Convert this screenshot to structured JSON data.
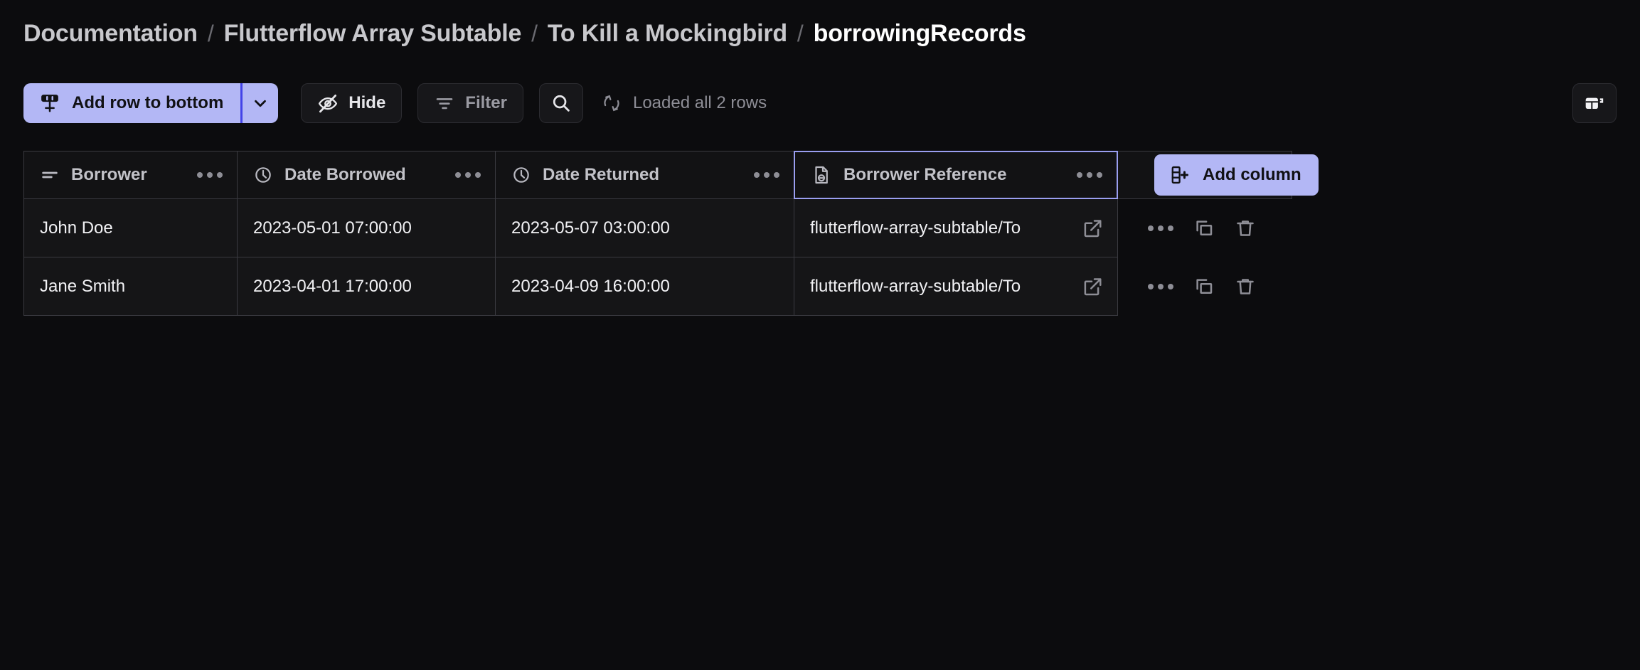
{
  "breadcrumb": {
    "separator": "/",
    "items": [
      {
        "label": "Documentation",
        "current": false
      },
      {
        "label": "Flutterflow Array Subtable",
        "current": false
      },
      {
        "label": "To Kill a Mockingbird",
        "current": false
      },
      {
        "label": "borrowingRecords",
        "current": true
      }
    ]
  },
  "toolbar": {
    "add_row_label": "Add row to bottom",
    "add_row_icon": "add-row-bottom-icon",
    "add_row_caret_icon": "chevron-down-icon",
    "hide_label": "Hide",
    "hide_icon": "eye-off-icon",
    "filter_label": "Filter",
    "filter_icon": "filter-icon",
    "search_icon": "search-icon",
    "status_icon": "refresh-icon",
    "status_label": "Loaded all 2 rows",
    "view_toggle_icon": "table-panel-icon"
  },
  "table": {
    "columns": [
      {
        "label": "Borrower",
        "icon": "text-lines-icon",
        "menu_icon": "ellipsis-icon",
        "selected": false
      },
      {
        "label": "Date Borrowed",
        "icon": "clock-icon",
        "menu_icon": "ellipsis-icon",
        "selected": false
      },
      {
        "label": "Date Returned",
        "icon": "clock-icon",
        "menu_icon": "ellipsis-icon",
        "selected": false
      },
      {
        "label": "Borrower Reference",
        "icon": "reference-doc-icon",
        "menu_icon": "ellipsis-icon",
        "selected": true
      }
    ],
    "add_column_label": "Add column",
    "add_column_icon": "add-column-icon",
    "rows": [
      {
        "borrower": "John Doe",
        "date_borrowed": "2023-05-01 07:00:00",
        "date_returned": "2023-05-07 03:00:00",
        "borrower_reference": "flutterflow-array-subtable/To",
        "reference_open_icon": "external-link-icon",
        "actions": [
          "ellipsis-icon",
          "duplicate-icon",
          "trash-icon"
        ]
      },
      {
        "borrower": "Jane Smith",
        "date_borrowed": "2023-04-01 17:00:00",
        "date_returned": "2023-04-09 16:00:00",
        "borrower_reference": "flutterflow-array-subtable/To",
        "reference_open_icon": "external-link-icon",
        "actions": [
          "ellipsis-icon",
          "duplicate-icon",
          "trash-icon"
        ]
      }
    ]
  },
  "colors": {
    "page_bg": "#0c0c0e",
    "accent": "#b3b7f5",
    "accent_divider": "#4343e8",
    "selection_border": "#9a9ef0",
    "panel_bg": "#17171a",
    "cell_bg": "#151517",
    "grid_border": "#3a3a40",
    "text_primary": "#f2f2f5",
    "text_muted": "#8e8e96"
  }
}
